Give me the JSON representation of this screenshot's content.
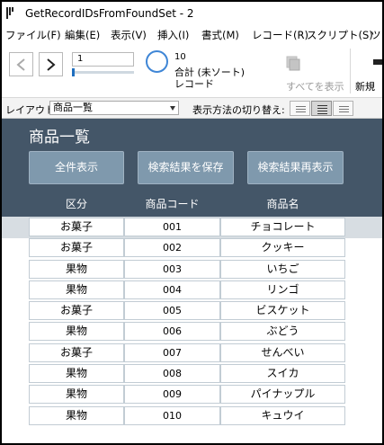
{
  "window": {
    "title": "GetRecordIDsFromFoundSet - 2"
  },
  "menu": [
    "ファイル(F)",
    "編集(E)",
    "表示(V)",
    "挿入(I)",
    "書式(M)",
    "レコード(R)",
    "スクリプト(S)",
    "ツ"
  ],
  "toolbar": {
    "record_value": "1",
    "record_count": "10",
    "record_total": "合計 (未ソート)",
    "record_label": "レコード",
    "show_all_label": "すべてを表示",
    "new_label": "新規"
  },
  "layoutbar": {
    "layout_label": "レイアウト:",
    "layout_value": "商品一覧",
    "view_label": "表示方法の切り替え:"
  },
  "header": {
    "title": "商品一覧",
    "buttons": [
      "全件表示",
      "検索結果を保存",
      "検索結果再表示"
    ],
    "columns": [
      "区分",
      "商品コード",
      "商品名"
    ]
  },
  "rows": [
    {
      "category": "お菓子",
      "code": "001",
      "name": "チョコレート"
    },
    {
      "category": "お菓子",
      "code": "002",
      "name": "クッキー"
    },
    {
      "category": "果物",
      "code": "003",
      "name": "いちご"
    },
    {
      "category": "果物",
      "code": "004",
      "name": "リンゴ"
    },
    {
      "category": "お菓子",
      "code": "005",
      "name": "ビスケット"
    },
    {
      "category": "果物",
      "code": "006",
      "name": "ぶどう"
    },
    {
      "category": "お菓子",
      "code": "007",
      "name": "せんべい"
    },
    {
      "category": "果物",
      "code": "008",
      "name": "スイカ"
    },
    {
      "category": "果物",
      "code": "009",
      "name": "パイナップル"
    },
    {
      "category": "果物",
      "code": "010",
      "name": "キュウイ"
    }
  ],
  "icons": {
    "app": "filemaker-app-icon",
    "prev": "chevron-left-icon",
    "next": "chevron-right-icon",
    "pie": "record-pie-icon",
    "show_all": "show-all-records-icon",
    "new": "new-record-icon"
  },
  "colors": {
    "header_bg": "#445668",
    "button_bg": "#7f99ad",
    "body_band": "#d7dde2",
    "pie_accent": "#3f86d6"
  }
}
